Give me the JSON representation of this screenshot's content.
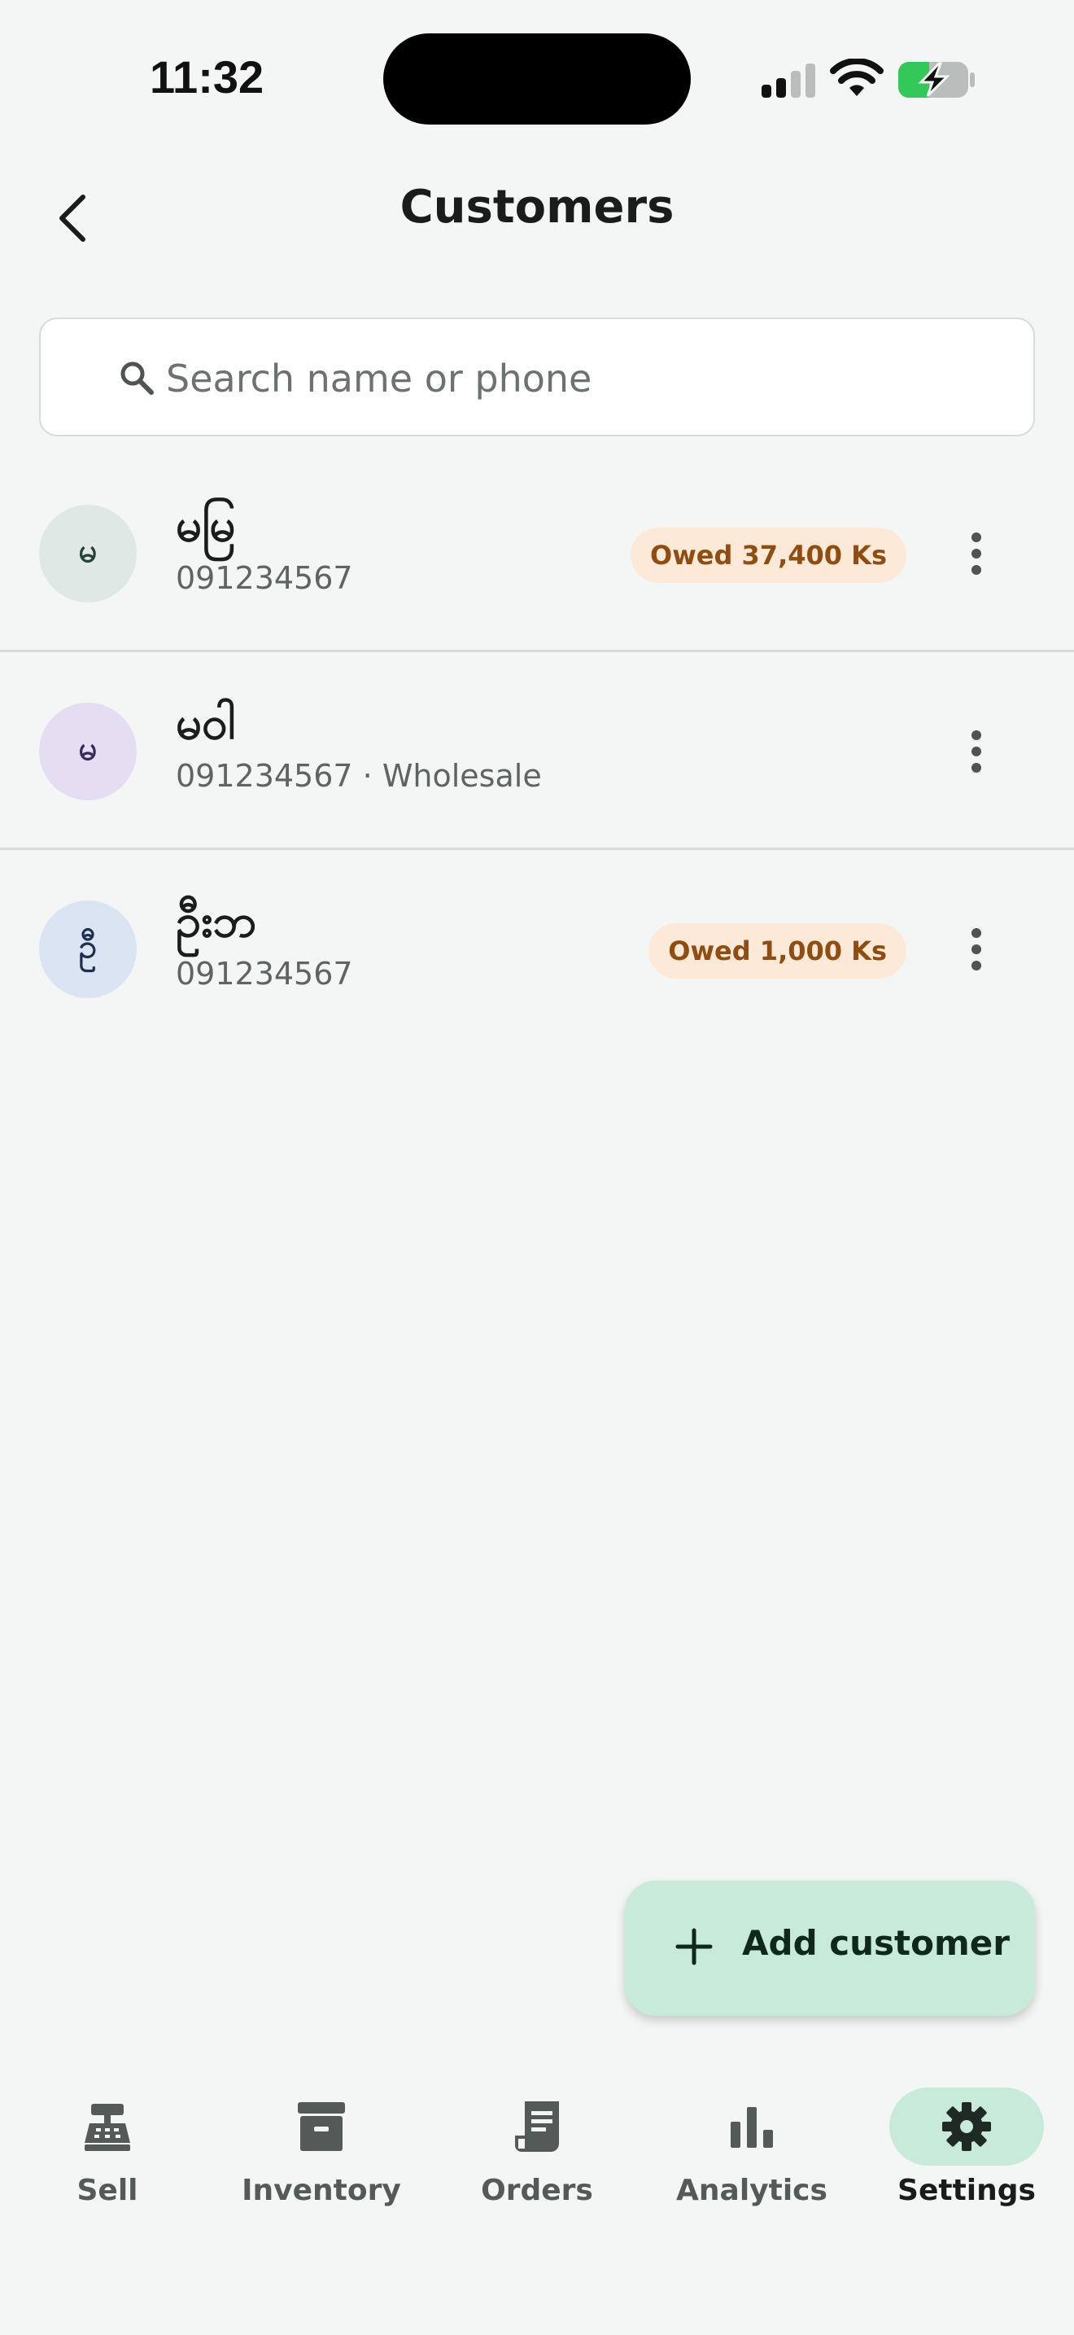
{
  "status_bar": {
    "time": "11:32",
    "icons": [
      "signal-icon",
      "wifi-icon",
      "battery-charging-icon"
    ]
  },
  "header": {
    "title": "Customers",
    "back_icon": "chevron-left-icon"
  },
  "search": {
    "placeholder": "Search name or phone",
    "value": "",
    "icon": "search-icon"
  },
  "customers": [
    {
      "avatar_initial": "မ",
      "avatar_bg": "#dfe8e4",
      "avatar_fg": "#27403a",
      "name": "မမြ",
      "subtitle": "091234567",
      "badge": "Owed 37,400 Ks"
    },
    {
      "avatar_initial": "မ",
      "avatar_bg": "#e5def2",
      "avatar_fg": "#3a2a58",
      "name": "မဝါ",
      "subtitle": "091234567 · Wholesale",
      "badge": ""
    },
    {
      "avatar_initial": "ဦ",
      "avatar_bg": "#dbe4f3",
      "avatar_fg": "#1e2f50",
      "name": "ဦးဘ",
      "subtitle": "091234567",
      "badge": "Owed 1,000 Ks"
    }
  ],
  "fab": {
    "label": "Add customer",
    "icon": "plus-icon"
  },
  "bottom_nav": [
    {
      "label": "Sell",
      "icon": "cash-register-icon",
      "active": false
    },
    {
      "label": "Inventory",
      "icon": "archive-box-icon",
      "active": false
    },
    {
      "label": "Orders",
      "icon": "receipt-icon",
      "active": false
    },
    {
      "label": "Analytics",
      "icon": "bar-chart-icon",
      "active": false
    },
    {
      "label": "Settings",
      "icon": "gear-icon",
      "active": true
    }
  ],
  "colors": {
    "accent": "#c8ead9",
    "badge_bg": "#fde9d8",
    "badge_text": "#8f4d12",
    "background": "#f4f6f5"
  }
}
